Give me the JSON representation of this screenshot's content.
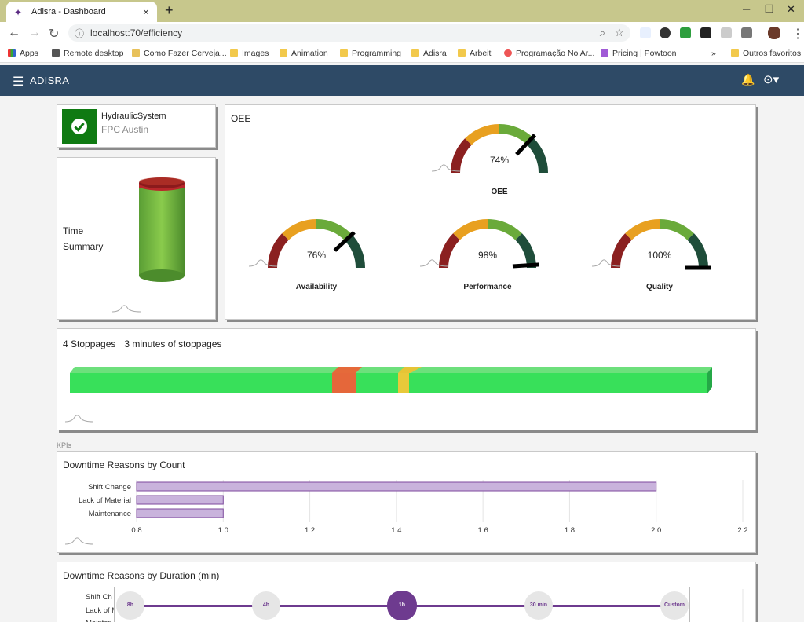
{
  "browser": {
    "tab_title": "Adisra - Dashboard",
    "url": "localhost:70/efficiency",
    "bookmarks": [
      "Apps",
      "Remote desktop",
      "Como Fazer Cerveja...",
      "Images",
      "Animation",
      "Programming",
      "Adisra",
      "Arbeit",
      "Programação No Ar...",
      "Pricing | Powtoon",
      "»",
      "Outros favoritos"
    ]
  },
  "app": {
    "brand": "ADISRA"
  },
  "asset": {
    "name": "HydraulicSystem",
    "location": "FPC Austin"
  },
  "time_summary": {
    "line1": "Time",
    "line2": "Summary"
  },
  "oee": {
    "title": "OEE",
    "gauges": [
      {
        "name": "OEE",
        "value": 74,
        "label": "74%"
      },
      {
        "name": "Availability",
        "value": 76,
        "label": "76%"
      },
      {
        "name": "Performance",
        "value": 98,
        "label": "98%"
      },
      {
        "name": "Quality",
        "value": 100,
        "label": "100%"
      }
    ]
  },
  "stoppages": {
    "count_text": "4 Stoppages",
    "duration_text": "3 minutes of stoppages"
  },
  "section_label": "KPIs",
  "chart_data": [
    {
      "type": "bar",
      "orientation": "horizontal",
      "title": "Downtime Reasons by Count",
      "categories": [
        "Shift Change",
        "Lack of Material",
        "Maintenance"
      ],
      "values": [
        2.0,
        1.0,
        1.0
      ],
      "xlim": [
        0.8,
        2.2
      ],
      "xticks": [
        "0.8",
        "1.0",
        "1.2",
        "1.4",
        "1.6",
        "1.8",
        "2.0",
        "2.2"
      ],
      "grid": true,
      "bar_color": "#c9b3dc",
      "bar_border": "#7e4a9e"
    },
    {
      "type": "bar",
      "orientation": "horizontal",
      "title": "Downtime Reasons by Duration (min)",
      "categories": [
        "Shift Ch",
        "Lack of Ma",
        "Mainten"
      ]
    }
  ],
  "timeline": {
    "options": [
      "8h",
      "4h",
      "1h",
      "30 min",
      "Custom"
    ],
    "selected": "1h"
  },
  "colors": {
    "header": "#2e4a66",
    "ok_green": "#0f7a12",
    "accent": "#6e3b8f"
  }
}
